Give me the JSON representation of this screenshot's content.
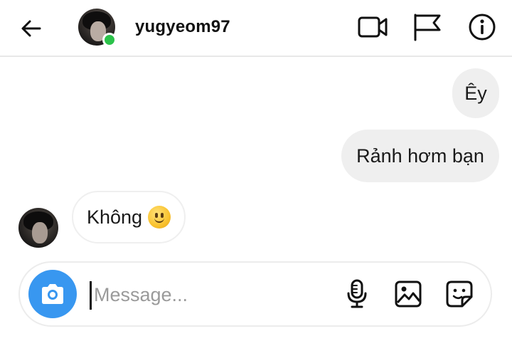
{
  "header": {
    "username": "yugyeom97",
    "online": true,
    "icons": [
      "back-arrow-icon",
      "video-call-icon",
      "flag-icon",
      "info-icon"
    ]
  },
  "messages": [
    {
      "direction": "outgoing",
      "text": "Êy"
    },
    {
      "direction": "outgoing",
      "text": "Rảnh hơm bạn"
    },
    {
      "direction": "incoming",
      "text": "Không",
      "emoji": "slightly-smiling-face"
    }
  ],
  "composer": {
    "placeholder": "Message...",
    "value": "",
    "icons": [
      "camera-icon",
      "microphone-icon",
      "gallery-icon",
      "sticker-icon"
    ]
  },
  "colors": {
    "accent": "#3897f0",
    "online": "#2bc24a",
    "outgoing_bubble": "#efefef",
    "divider": "#e8e8e8"
  }
}
